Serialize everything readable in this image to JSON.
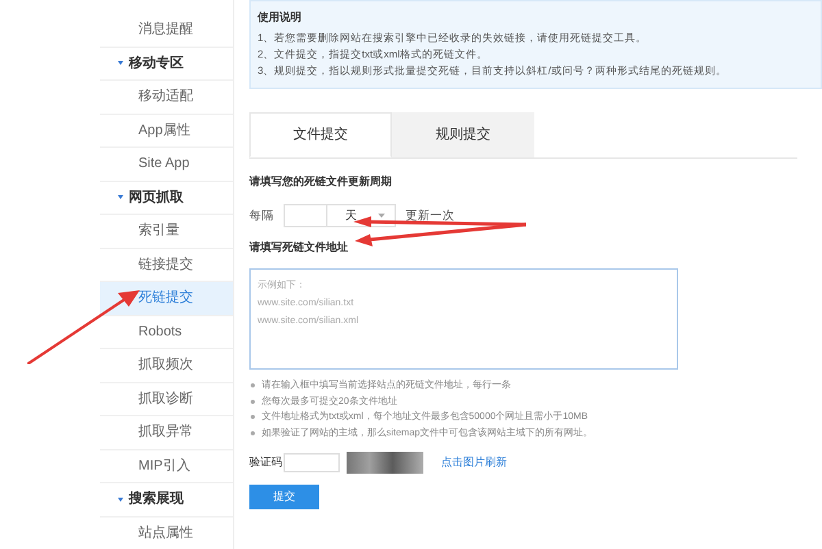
{
  "sidebar": {
    "items": [
      {
        "kind": "item",
        "label": "消息提醒",
        "selected": false
      },
      {
        "kind": "header",
        "label": "移动专区",
        "expanded": true
      },
      {
        "kind": "item",
        "label": "移动适配",
        "selected": false
      },
      {
        "kind": "item",
        "label": "App属性",
        "selected": false
      },
      {
        "kind": "item",
        "label": "Site App",
        "selected": false
      },
      {
        "kind": "header",
        "label": "网页抓取",
        "expanded": true
      },
      {
        "kind": "item",
        "label": "索引量",
        "selected": false
      },
      {
        "kind": "item",
        "label": "链接提交",
        "selected": false
      },
      {
        "kind": "item",
        "label": "死链提交",
        "selected": true
      },
      {
        "kind": "item",
        "label": "Robots",
        "selected": false
      },
      {
        "kind": "item",
        "label": "抓取频次",
        "selected": false
      },
      {
        "kind": "item",
        "label": "抓取诊断",
        "selected": false
      },
      {
        "kind": "item",
        "label": "抓取异常",
        "selected": false
      },
      {
        "kind": "item",
        "label": "MIP引入",
        "selected": false
      },
      {
        "kind": "header",
        "label": "搜索展现",
        "expanded": true
      },
      {
        "kind": "item",
        "label": "站点属性",
        "selected": false
      }
    ]
  },
  "notice": {
    "title": "使用说明",
    "lines": [
      "1、若您需要删除网站在搜索引擎中已经收录的失效链接，请使用死链提交工具。",
      "2、文件提交，指提交txt或xml格式的死链文件。",
      "3、规则提交，指以规则形式批量提交死链，目前支持以斜杠/或问号？两种形式结尾的死链规则。"
    ]
  },
  "tabs": [
    {
      "label": "文件提交",
      "selected": true
    },
    {
      "label": "规则提交",
      "selected": false
    }
  ],
  "update_period": {
    "heading": "请填写您的死链文件更新周期",
    "prefix": "每隔",
    "unit": "天",
    "suffix": "更新一次"
  },
  "address": {
    "heading": "请填写死链文件地址",
    "placeholder": "示例如下：\nwww.site.com/silian.txt\nwww.site.com/silian.xml"
  },
  "notes": [
    "请在输入框中填写当前选择站点的死链文件地址，每行一条",
    "您每次最多可提交20条文件地址",
    "文件地址格式为txt或xml，每个地址文件最多包含50000个网址且需小于10MB",
    "如果验证了网站的主域，那么sitemap文件中可包含该网站主域下的所有网址。"
  ],
  "captcha": {
    "label": "验证码",
    "refresh_link": "点击图片刷新"
  },
  "submit": "提交"
}
